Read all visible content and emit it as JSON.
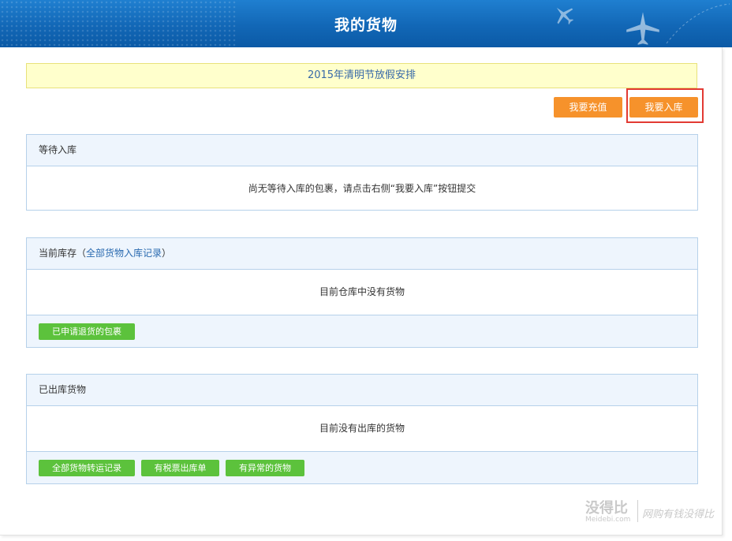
{
  "header": {
    "title": "我的货物"
  },
  "notice": {
    "text": "2015年清明节放假安排"
  },
  "actions": {
    "recharge_label": "我要充值",
    "inbound_label": "我要入库"
  },
  "pending": {
    "title": "等待入库",
    "empty_text": "尚无等待入库的包裹，请点击右侧“我要入库”按钮提交"
  },
  "inventory": {
    "title": "当前库存",
    "link_open": "（",
    "link_label": "全部货物入库记录",
    "link_close": "）",
    "empty_text": "目前仓库中没有货物",
    "return_button": "已申请退货的包裹"
  },
  "outbound": {
    "title": "已出库货物",
    "empty_text": "目前没有出库的货物",
    "buttons": [
      "全部货物转运记录",
      "有税票出库单",
      "有异常的货物"
    ]
  },
  "watermark": {
    "brand": "没得比",
    "domain": "Meidebi.com",
    "slogan": "网购有钱没得比"
  },
  "colors": {
    "header_blue": "#1267b6",
    "orange": "#f6922b",
    "green": "#5cc23c",
    "highlight_red": "#e23a33",
    "panel_border": "#b6d1ea"
  }
}
